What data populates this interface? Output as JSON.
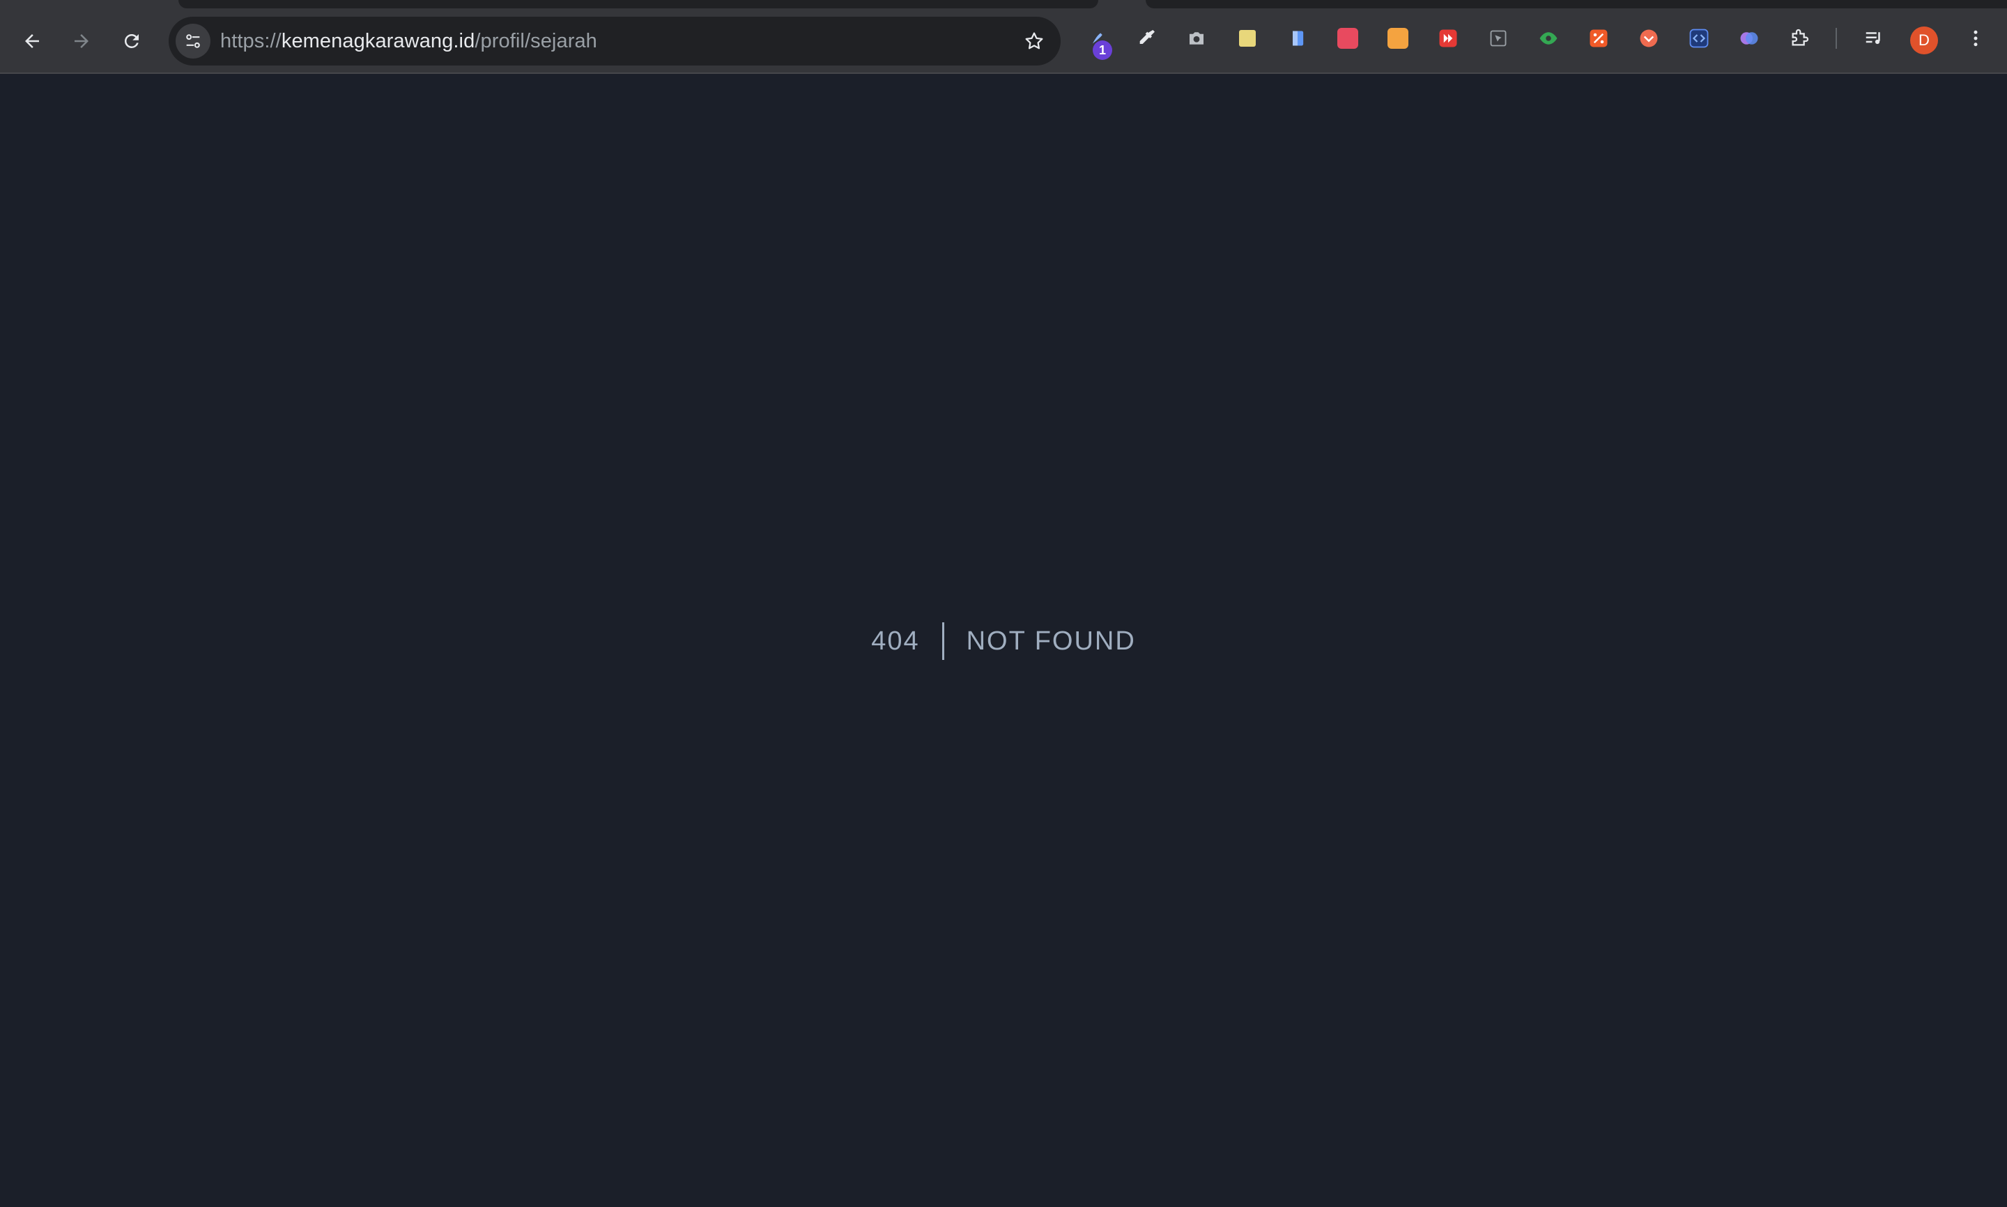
{
  "browser": {
    "url_scheme": "https://",
    "url_host": "kemenagkarawang.id",
    "url_path": "/profil/sejarah",
    "extension_badge": "1",
    "profile_initial": "D",
    "extensions": [
      {
        "icon": "pen-wave-icon",
        "color": "#8ab4f8"
      },
      {
        "icon": "eyedropper-icon",
        "color": "#e8eaed"
      },
      {
        "icon": "camera-icon",
        "color": "#bdc1c6"
      },
      {
        "icon": "note-icon",
        "color": "#e8d77b"
      },
      {
        "icon": "document-icon",
        "color": "#5e97f6"
      },
      {
        "icon": "dots-grid-icon",
        "color": "#e84a5f"
      },
      {
        "icon": "layout-icon",
        "color": "#f4a340"
      },
      {
        "icon": "fast-forward-icon",
        "color": "#e53935"
      },
      {
        "icon": "cursor-arrow-icon",
        "color": "#9aa0a6"
      },
      {
        "icon": "eye-icon",
        "color": "#34a853"
      },
      {
        "icon": "percent-icon",
        "color": "#f05a28"
      },
      {
        "icon": "pocket-icon",
        "color": "#ef6b50"
      },
      {
        "icon": "code-icon",
        "color": "#5e8df5"
      },
      {
        "icon": "brain-icon",
        "color": "#a678e6"
      },
      {
        "icon": "puzzle-icon",
        "color": "#e8eaed"
      },
      {
        "icon": "media-queue-icon",
        "color": "#e8eaed"
      }
    ]
  },
  "page": {
    "error_code": "404",
    "error_message": "NOT FOUND"
  }
}
